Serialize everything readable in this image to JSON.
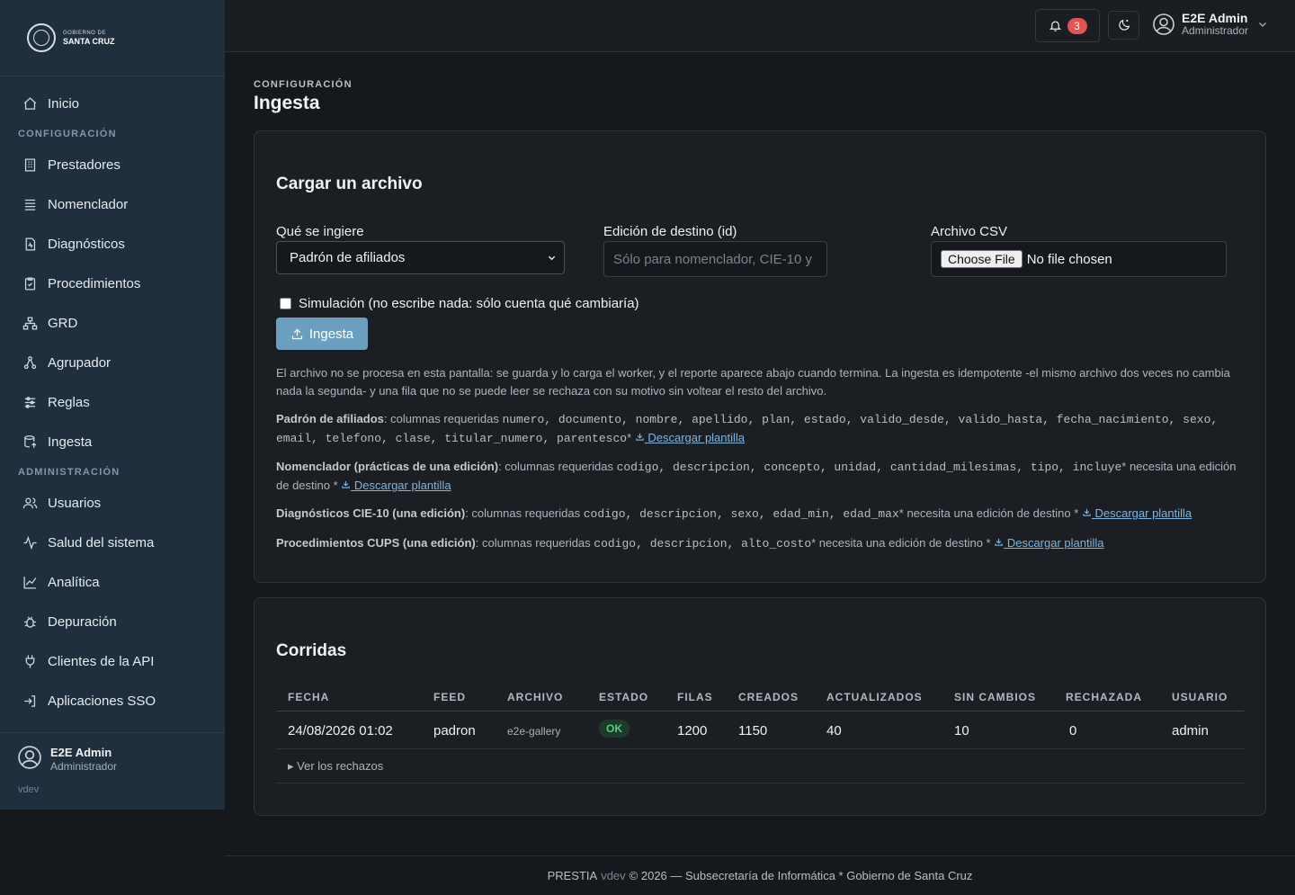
{
  "brand": {
    "line1": "GOBIERNO DE",
    "line2": "SANTA CRUZ"
  },
  "sidebar": {
    "home": {
      "label": "Inicio",
      "icon": "home-icon"
    },
    "section_config": "CONFIGURACIÓN",
    "config_items": [
      {
        "label": "Prestadores",
        "icon": "building-icon"
      },
      {
        "label": "Nomenclador",
        "icon": "list-icon"
      },
      {
        "label": "Diagnósticos",
        "icon": "file-medical-icon"
      },
      {
        "label": "Procedimientos",
        "icon": "clipboard-check-icon"
      },
      {
        "label": "GRD",
        "icon": "hierarchy-icon"
      },
      {
        "label": "Agrupador",
        "icon": "network-icon"
      },
      {
        "label": "Reglas",
        "icon": "sliders-icon"
      },
      {
        "label": "Ingesta",
        "icon": "database-upload-icon"
      }
    ],
    "section_admin": "ADMINISTRACIÓN",
    "admin_items": [
      {
        "label": "Usuarios",
        "icon": "users-icon"
      },
      {
        "label": "Salud del sistema",
        "icon": "activity-icon"
      },
      {
        "label": "Analítica",
        "icon": "chart-line-icon"
      },
      {
        "label": "Depuración",
        "icon": "bug-icon"
      },
      {
        "label": "Clientes de la API",
        "icon": "plug-icon"
      },
      {
        "label": "Aplicaciones SSO",
        "icon": "login-icon"
      }
    ],
    "user": {
      "name": "E2E Admin",
      "role": "Administrador"
    },
    "version": "vdev"
  },
  "topbar": {
    "notifications_count": "3",
    "user": {
      "name": "E2E Admin",
      "role": "Administrador"
    }
  },
  "page": {
    "breadcrumb": "CONFIGURACIÓN",
    "title": "Ingesta"
  },
  "upload": {
    "title": "Cargar un archivo",
    "feed_label": "Qué se ingiere",
    "feed_selected": "Padrón de afiliados",
    "edition_label": "Edición de destino (id)",
    "edition_placeholder": "Sólo para nomenclador, CIE-10 y",
    "file_label": "Archivo CSV",
    "file_button": "Choose File",
    "file_status": "No file chosen",
    "simulation_label": "Simulación (no escribe nada: sólo cuenta qué cambiaría)",
    "submit_label": "Ingesta",
    "help_intro": "El archivo no se procesa en esta pantalla: se guarda y lo carga el worker, y el reporte aparece abajo cuando termina. La ingesta es idempotente -el mismo archivo dos veces no cambia nada la segunda- y una fila que no se puede leer se rechaza con su motivo sin voltear el resto del archivo.",
    "download_label": " Descargar plantilla",
    "feeds_help": [
      {
        "name": "Padrón de afiliados",
        "prefix": ": columnas requeridas ",
        "columns": "numero, documento, nombre, apellido, plan, estado, valido_desde, valido_hasta, fecha_nacimiento, sexo, email, telefono, clase, titular_numero, parentesco",
        "suffix": "* "
      },
      {
        "name": "Nomenclador (prácticas de una edición)",
        "prefix": ": columnas requeridas ",
        "columns": "codigo, descripcion, concepto, unidad, cantidad_milesimas, tipo, incluye",
        "suffix": "* necesita una edición de destino * "
      },
      {
        "name": "Diagnósticos CIE-10 (una edición)",
        "prefix": ": columnas requeridas ",
        "columns": "codigo, descripcion, sexo, edad_min, edad_max",
        "suffix": "* necesita una edición de destino * "
      },
      {
        "name": "Procedimientos CUPS (una edición)",
        "prefix": ": columnas requeridas ",
        "columns": "codigo, descripcion, alto_costo",
        "suffix": "* necesita una edición de destino * "
      }
    ]
  },
  "runs": {
    "title": "Corridas",
    "columns": [
      "FECHA",
      "FEED",
      "ARCHIVO",
      "ESTADO",
      "FILAS",
      "CREADOS",
      "ACTUALIZADOS",
      "SIN CAMBIOS",
      "RECHAZADA",
      "USUARIO"
    ],
    "rows": [
      {
        "fecha": "24/08/2026 01:02",
        "feed": "padron",
        "archivo": "e2e-gallery",
        "estado": "OK",
        "filas": "1200",
        "creados": "1150",
        "actualizados": "40",
        "sin_cambios": "10",
        "rechazada": "0",
        "usuario": "admin"
      }
    ],
    "rejects_toggle": "▸ Ver los rechazos"
  },
  "footer": {
    "app": "PRESTIA",
    "version": "vdev",
    "rest": "© 2026 — Subsecretaría de Informática * Gobierno de Santa Cruz"
  },
  "colors": {
    "primary_button": "#6b9fc0",
    "sidebar_bg": "#1f2f3d",
    "ok_badge": "#4ccf7e",
    "notification_badge": "#e05452"
  }
}
